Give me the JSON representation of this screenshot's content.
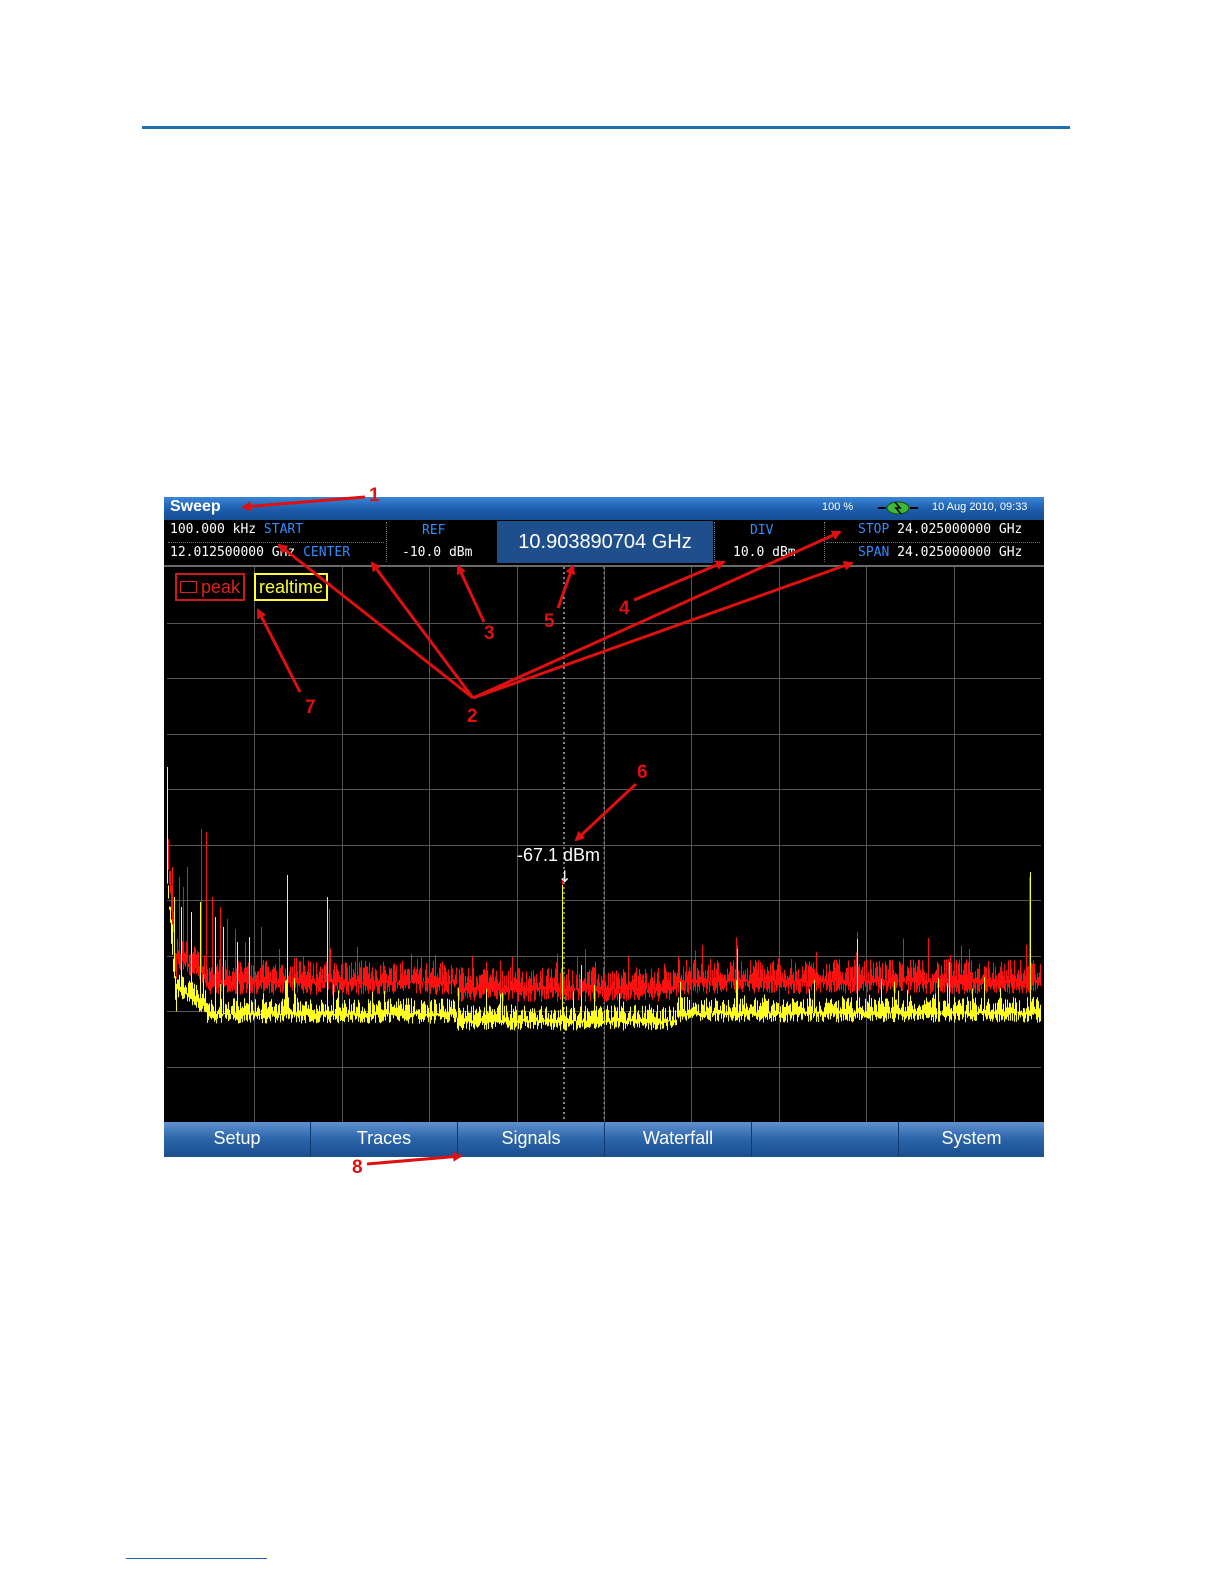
{
  "screen": {
    "titlebar": {
      "title": "Sweep",
      "battery": "100 %",
      "datetime": "10 Aug 2010, 09:33",
      "status_icon": "connection-plug-icon"
    },
    "infobar": {
      "start_value": "100.000 kHz",
      "start_label": "START",
      "center_value": "12.012500000 GHz",
      "center_label": "CENTER",
      "ref_label": "REF",
      "ref_value": "-10.0 dBm",
      "marker_frequency": "10.903890704 GHz",
      "div_label": "DIV",
      "div_value": "10.0 dBm",
      "stop_label": "STOP",
      "stop_value": "24.025000000 GHz",
      "span_label": "SPAN",
      "span_value": "24.025000000 GHz"
    },
    "plot": {
      "badges": {
        "peak": "peak",
        "realtime": "realtime"
      },
      "marker_label": "-67.1 dBm",
      "marker_arrow": "↓",
      "colors": {
        "peak_trace": "#ff1010",
        "realtime_trace": "#ffff22",
        "grid": "#555555",
        "background": "#000000"
      },
      "grid": {
        "columns": 10,
        "rows": 10
      }
    },
    "tabs": [
      "Setup",
      "Traces",
      "Signals",
      "Waterfall",
      "",
      "System"
    ]
  },
  "callouts": [
    "1",
    "2",
    "3",
    "4",
    "5",
    "6",
    "7",
    "8"
  ],
  "colors": {
    "page_rule": "#1f6fb5",
    "callout": "#e01010",
    "titlebar": "#1c5cab",
    "accent_text": "#2f8dff"
  }
}
